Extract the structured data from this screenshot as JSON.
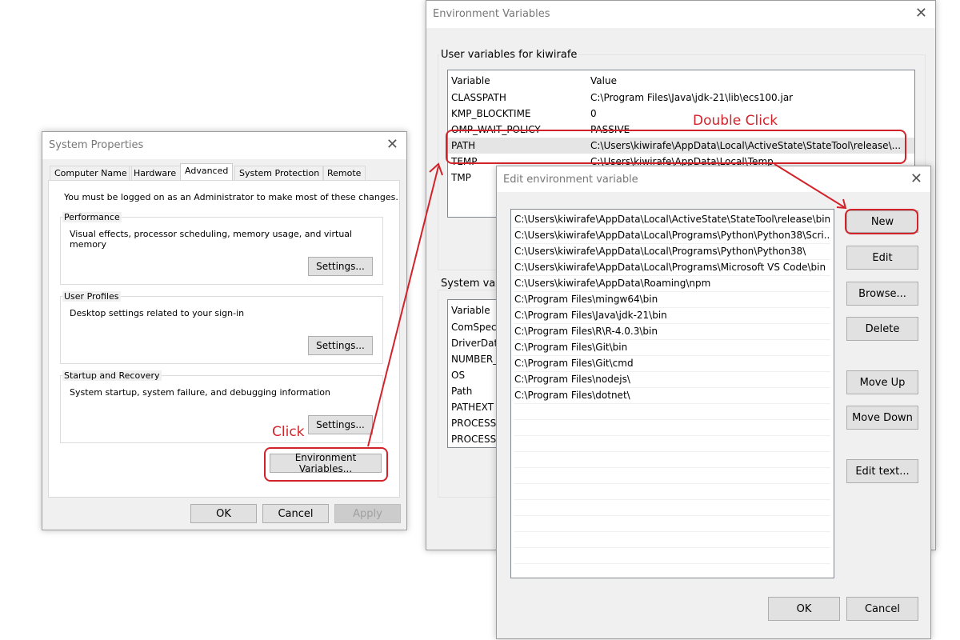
{
  "system_properties": {
    "title": "System Properties",
    "tabs": [
      "Computer Name",
      "Hardware",
      "Advanced",
      "System Protection",
      "Remote"
    ],
    "admin_note": "You must be logged on as an Administrator to make most of these changes.",
    "performance": {
      "title": "Performance",
      "desc": "Visual effects, processor scheduling, memory usage, and virtual memory",
      "button": "Settings..."
    },
    "user_profiles": {
      "title": "User Profiles",
      "desc": "Desktop settings related to your sign-in",
      "button": "Settings..."
    },
    "startup": {
      "title": "Startup and Recovery",
      "desc": "System startup, system failure, and debugging information",
      "button": "Settings..."
    },
    "env_button": "Environment Variables...",
    "ok": "OK",
    "cancel": "Cancel",
    "apply": "Apply"
  },
  "env_vars": {
    "title": "Environment Variables",
    "user_section": "User variables for kiwirafe",
    "columns": [
      "Variable",
      "Value"
    ],
    "user_rows": [
      {
        "name": "CLASSPATH",
        "value": "C:\\Program Files\\Java\\jdk-21\\lib\\ecs100.jar"
      },
      {
        "name": "KMP_BLOCKTIME",
        "value": "0"
      },
      {
        "name": "OMP_WAIT_POLICY",
        "value": "PASSIVE"
      },
      {
        "name": "PATH",
        "value": "C:\\Users\\kiwirafe\\AppData\\Local\\ActiveState\\StateTool\\release\\..."
      },
      {
        "name": "TEMP",
        "value": "C:\\Users\\kiwirafe\\AppData\\Local\\Temp"
      },
      {
        "name": "TMP",
        "value": ""
      }
    ],
    "system_section": "System vari",
    "system_rows": [
      "ComSpec",
      "DriverData",
      "NUMBER_",
      "OS",
      "Path",
      "PATHEXT",
      "PROCESSO",
      "PROCESSO"
    ]
  },
  "edit_env": {
    "title": "Edit environment variable",
    "paths": [
      "C:\\Users\\kiwirafe\\AppData\\Local\\ActiveState\\StateTool\\release\\bin",
      "C:\\Users\\kiwirafe\\AppData\\Local\\Programs\\Python\\Python38\\Scri...",
      "C:\\Users\\kiwirafe\\AppData\\Local\\Programs\\Python\\Python38\\",
      "C:\\Users\\kiwirafe\\AppData\\Local\\Programs\\Microsoft VS Code\\bin",
      "C:\\Users\\kiwirafe\\AppData\\Roaming\\npm",
      "C:\\Program Files\\mingw64\\bin",
      "C:\\Program Files\\Java\\jdk-21\\bin",
      "C:\\Program Files\\R\\R-4.0.3\\bin",
      "C:\\Program Files\\Git\\bin",
      "C:\\Program Files\\Git\\cmd",
      "C:\\Program Files\\nodejs\\",
      "C:\\Program Files\\dotnet\\"
    ],
    "buttons": {
      "new": "New",
      "edit": "Edit",
      "browse": "Browse...",
      "delete": "Delete",
      "move_up": "Move Up",
      "move_down": "Move Down",
      "edit_text": "Edit text..."
    },
    "ok": "OK",
    "cancel": "Cancel"
  },
  "annotations": {
    "click": "Click",
    "double_click": "Double Click",
    "color": "#d2232a"
  },
  "icons": {
    "close": "✕"
  }
}
